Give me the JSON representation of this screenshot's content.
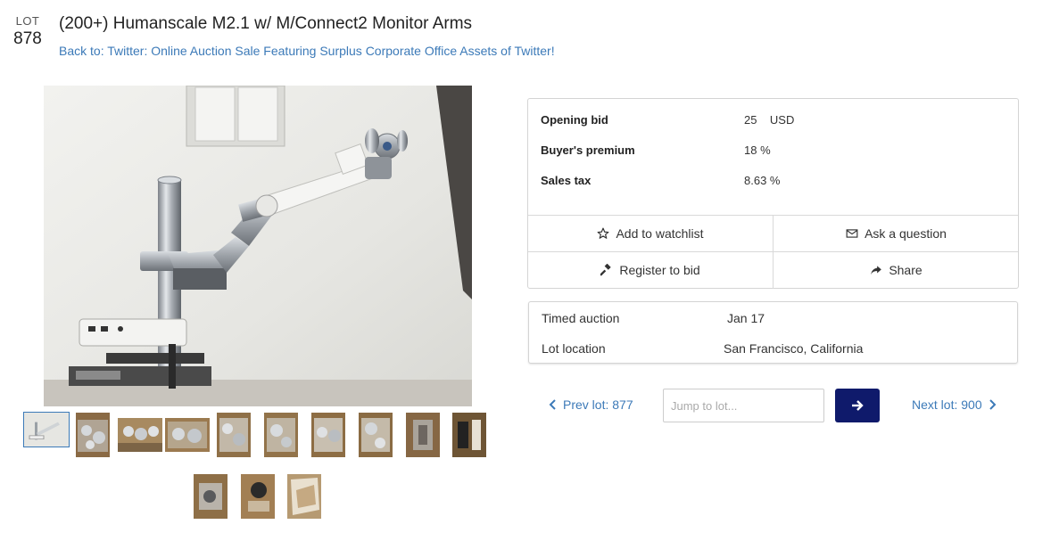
{
  "lot": {
    "label": "LOT",
    "number": "878",
    "title": "(200+) Humanscale M2.1 w/ M/Connect2 Monitor Arms",
    "back_link": "Back to: Twitter: Online Auction Sale Featuring Surplus Corporate Office Assets of Twitter!"
  },
  "bid_info": {
    "opening_bid_label": "Opening bid",
    "opening_bid_value": "25",
    "opening_bid_currency": "USD",
    "buyers_premium_label": "Buyer's premium",
    "buyers_premium_value": "18 %",
    "sales_tax_label": "Sales tax",
    "sales_tax_value": "8.63 %"
  },
  "actions": {
    "watchlist": "Add to watchlist",
    "ask_question": "Ask a question",
    "register": "Register to bid",
    "share": "Share"
  },
  "auction": {
    "type_label": "Timed auction",
    "type_value": "Jan 17",
    "location_label": "Lot location",
    "location_value": "San Francisco, California"
  },
  "navigation": {
    "prev": "Prev lot: 877",
    "next": "Next lot: 900",
    "jump_placeholder": "Jump to lot..."
  },
  "icons": {
    "watchlist": "star-icon",
    "ask": "envelope-icon",
    "register": "gavel-icon",
    "share": "share-arrow-icon",
    "prev": "chevron-left-icon",
    "next": "chevron-right-icon",
    "go": "arrow-right-icon"
  },
  "colors": {
    "link": "#3c7ab8",
    "go_button": "#0f1a6b",
    "border": "#d4d4d4"
  },
  "thumbnail_count": 13
}
